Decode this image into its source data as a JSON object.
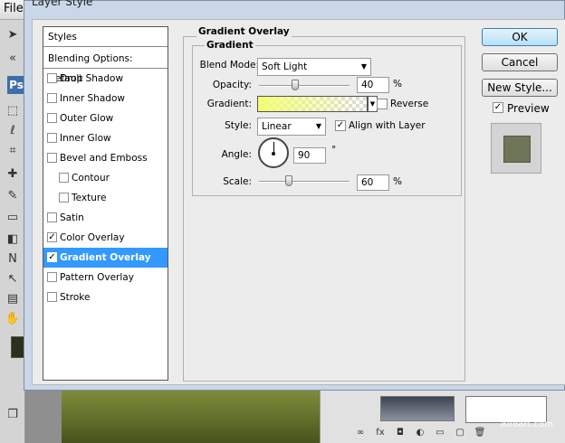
{
  "app": {
    "menu_file": "File",
    "watermark": "Alfoart.com",
    "toolbox_badge": "Ps"
  },
  "dialog": {
    "title": "Layer Style",
    "styles_header": "Styles",
    "blending_options": "Blending Options: Default",
    "effects": [
      {
        "label": "Drop Shadow",
        "checked": false,
        "sub": false,
        "selected": false
      },
      {
        "label": "Inner Shadow",
        "checked": false,
        "sub": false,
        "selected": false
      },
      {
        "label": "Outer Glow",
        "checked": false,
        "sub": false,
        "selected": false
      },
      {
        "label": "Inner Glow",
        "checked": false,
        "sub": false,
        "selected": false
      },
      {
        "label": "Bevel and Emboss",
        "checked": false,
        "sub": false,
        "selected": false
      },
      {
        "label": "Contour",
        "checked": false,
        "sub": true,
        "selected": false
      },
      {
        "label": "Texture",
        "checked": false,
        "sub": true,
        "selected": false
      },
      {
        "label": "Satin",
        "checked": false,
        "sub": false,
        "selected": false
      },
      {
        "label": "Color Overlay",
        "checked": true,
        "sub": false,
        "selected": false
      },
      {
        "label": "Gradient Overlay",
        "checked": true,
        "sub": false,
        "selected": true
      },
      {
        "label": "Pattern Overlay",
        "checked": false,
        "sub": false,
        "selected": false
      },
      {
        "label": "Stroke",
        "checked": false,
        "sub": false,
        "selected": false
      }
    ],
    "panel": {
      "title": "Gradient Overlay",
      "group_title": "Gradient",
      "blend_mode_label": "Blend Mode:",
      "blend_mode_value": "Soft Light",
      "opacity_label": "Opacity:",
      "opacity_value": "40",
      "opacity_unit": "%",
      "opacity_fraction": 0.4,
      "gradient_label": "Gradient:",
      "gradient_color": "#f2ff73",
      "reverse_label": "Reverse",
      "reverse_checked": false,
      "style_label": "Style:",
      "style_value": "Linear",
      "align_label": "Align with Layer",
      "align_checked": true,
      "angle_label": "Angle:",
      "angle_value": "90",
      "angle_unit": "°",
      "scale_label": "Scale:",
      "scale_value": "60",
      "scale_unit": "%",
      "scale_fraction": 0.33
    },
    "buttons": {
      "ok": "OK",
      "reset": "Cancel",
      "new_style": "New Style...",
      "preview_label": "Preview",
      "preview_checked": true
    },
    "preview_color": "#6f7559"
  }
}
